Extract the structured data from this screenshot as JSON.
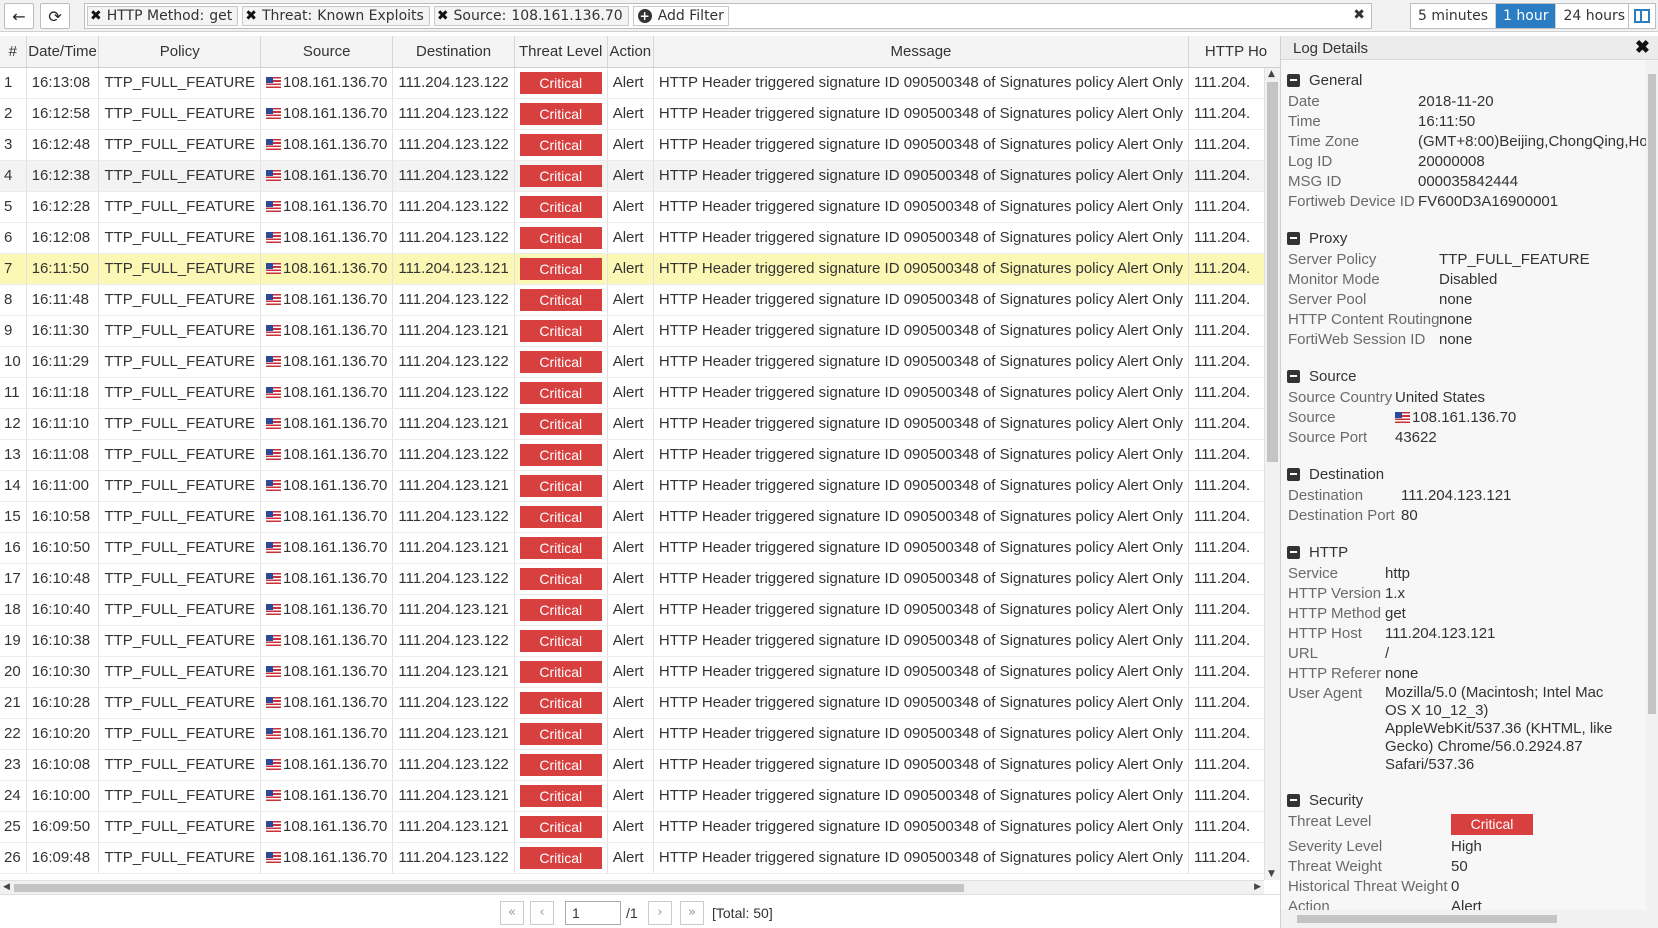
{
  "toolbar": {
    "filters": [
      {
        "key": "HTTP Method:",
        "value": "get"
      },
      {
        "key": "Threat:",
        "value": "Known Exploits"
      },
      {
        "key": "Source:",
        "value": "108.161.136.70"
      }
    ],
    "add_filter_label": "Add Filter",
    "time_ranges": [
      "5 minutes",
      "1 hour",
      "24 hours"
    ],
    "active_time_range": "1 hour"
  },
  "table": {
    "columns": [
      "#",
      "Date/Time",
      "Policy",
      "Source",
      "Destination",
      "Threat Level",
      "Action",
      "Message",
      "HTTP Ho"
    ],
    "rows": [
      {
        "n": "1",
        "time": "16:13:08",
        "policy": "TTP_FULL_FEATURE",
        "src": "108.161.136.70",
        "dst": "111.204.123.122",
        "level": "Critical",
        "action": "Alert",
        "msg": "HTTP Header triggered signature ID 090500348 of Signatures policy Alert Only",
        "host": "111.204."
      },
      {
        "n": "2",
        "time": "16:12:58",
        "policy": "TTP_FULL_FEATURE",
        "src": "108.161.136.70",
        "dst": "111.204.123.122",
        "level": "Critical",
        "action": "Alert",
        "msg": "HTTP Header triggered signature ID 090500348 of Signatures policy Alert Only",
        "host": "111.204."
      },
      {
        "n": "3",
        "time": "16:12:48",
        "policy": "TTP_FULL_FEATURE",
        "src": "108.161.136.70",
        "dst": "111.204.123.122",
        "level": "Critical",
        "action": "Alert",
        "msg": "HTTP Header triggered signature ID 090500348 of Signatures policy Alert Only",
        "host": "111.204."
      },
      {
        "n": "4",
        "time": "16:12:38",
        "policy": "TTP_FULL_FEATURE",
        "src": "108.161.136.70",
        "dst": "111.204.123.122",
        "level": "Critical",
        "action": "Alert",
        "msg": "HTTP Header triggered signature ID 090500348 of Signatures policy Alert Only",
        "host": "111.204."
      },
      {
        "n": "5",
        "time": "16:12:28",
        "policy": "TTP_FULL_FEATURE",
        "src": "108.161.136.70",
        "dst": "111.204.123.122",
        "level": "Critical",
        "action": "Alert",
        "msg": "HTTP Header triggered signature ID 090500348 of Signatures policy Alert Only",
        "host": "111.204."
      },
      {
        "n": "6",
        "time": "16:12:08",
        "policy": "TTP_FULL_FEATURE",
        "src": "108.161.136.70",
        "dst": "111.204.123.122",
        "level": "Critical",
        "action": "Alert",
        "msg": "HTTP Header triggered signature ID 090500348 of Signatures policy Alert Only",
        "host": "111.204."
      },
      {
        "n": "7",
        "time": "16:11:50",
        "policy": "TTP_FULL_FEATURE",
        "src": "108.161.136.70",
        "dst": "111.204.123.121",
        "level": "Critical",
        "action": "Alert",
        "msg": "HTTP Header triggered signature ID 090500348 of Signatures policy Alert Only",
        "host": "111.204."
      },
      {
        "n": "8",
        "time": "16:11:48",
        "policy": "TTP_FULL_FEATURE",
        "src": "108.161.136.70",
        "dst": "111.204.123.122",
        "level": "Critical",
        "action": "Alert",
        "msg": "HTTP Header triggered signature ID 090500348 of Signatures policy Alert Only",
        "host": "111.204."
      },
      {
        "n": "9",
        "time": "16:11:30",
        "policy": "TTP_FULL_FEATURE",
        "src": "108.161.136.70",
        "dst": "111.204.123.121",
        "level": "Critical",
        "action": "Alert",
        "msg": "HTTP Header triggered signature ID 090500348 of Signatures policy Alert Only",
        "host": "111.204."
      },
      {
        "n": "10",
        "time": "16:11:29",
        "policy": "TTP_FULL_FEATURE",
        "src": "108.161.136.70",
        "dst": "111.204.123.122",
        "level": "Critical",
        "action": "Alert",
        "msg": "HTTP Header triggered signature ID 090500348 of Signatures policy Alert Only",
        "host": "111.204."
      },
      {
        "n": "11",
        "time": "16:11:18",
        "policy": "TTP_FULL_FEATURE",
        "src": "108.161.136.70",
        "dst": "111.204.123.122",
        "level": "Critical",
        "action": "Alert",
        "msg": "HTTP Header triggered signature ID 090500348 of Signatures policy Alert Only",
        "host": "111.204."
      },
      {
        "n": "12",
        "time": "16:11:10",
        "policy": "TTP_FULL_FEATURE",
        "src": "108.161.136.70",
        "dst": "111.204.123.121",
        "level": "Critical",
        "action": "Alert",
        "msg": "HTTP Header triggered signature ID 090500348 of Signatures policy Alert Only",
        "host": "111.204."
      },
      {
        "n": "13",
        "time": "16:11:08",
        "policy": "TTP_FULL_FEATURE",
        "src": "108.161.136.70",
        "dst": "111.204.123.122",
        "level": "Critical",
        "action": "Alert",
        "msg": "HTTP Header triggered signature ID 090500348 of Signatures policy Alert Only",
        "host": "111.204."
      },
      {
        "n": "14",
        "time": "16:11:00",
        "policy": "TTP_FULL_FEATURE",
        "src": "108.161.136.70",
        "dst": "111.204.123.121",
        "level": "Critical",
        "action": "Alert",
        "msg": "HTTP Header triggered signature ID 090500348 of Signatures policy Alert Only",
        "host": "111.204."
      },
      {
        "n": "15",
        "time": "16:10:58",
        "policy": "TTP_FULL_FEATURE",
        "src": "108.161.136.70",
        "dst": "111.204.123.122",
        "level": "Critical",
        "action": "Alert",
        "msg": "HTTP Header triggered signature ID 090500348 of Signatures policy Alert Only",
        "host": "111.204."
      },
      {
        "n": "16",
        "time": "16:10:50",
        "policy": "TTP_FULL_FEATURE",
        "src": "108.161.136.70",
        "dst": "111.204.123.121",
        "level": "Critical",
        "action": "Alert",
        "msg": "HTTP Header triggered signature ID 090500348 of Signatures policy Alert Only",
        "host": "111.204."
      },
      {
        "n": "17",
        "time": "16:10:48",
        "policy": "TTP_FULL_FEATURE",
        "src": "108.161.136.70",
        "dst": "111.204.123.122",
        "level": "Critical",
        "action": "Alert",
        "msg": "HTTP Header triggered signature ID 090500348 of Signatures policy Alert Only",
        "host": "111.204."
      },
      {
        "n": "18",
        "time": "16:10:40",
        "policy": "TTP_FULL_FEATURE",
        "src": "108.161.136.70",
        "dst": "111.204.123.121",
        "level": "Critical",
        "action": "Alert",
        "msg": "HTTP Header triggered signature ID 090500348 of Signatures policy Alert Only",
        "host": "111.204."
      },
      {
        "n": "19",
        "time": "16:10:38",
        "policy": "TTP_FULL_FEATURE",
        "src": "108.161.136.70",
        "dst": "111.204.123.122",
        "level": "Critical",
        "action": "Alert",
        "msg": "HTTP Header triggered signature ID 090500348 of Signatures policy Alert Only",
        "host": "111.204."
      },
      {
        "n": "20",
        "time": "16:10:30",
        "policy": "TTP_FULL_FEATURE",
        "src": "108.161.136.70",
        "dst": "111.204.123.121",
        "level": "Critical",
        "action": "Alert",
        "msg": "HTTP Header triggered signature ID 090500348 of Signatures policy Alert Only",
        "host": "111.204."
      },
      {
        "n": "21",
        "time": "16:10:28",
        "policy": "TTP_FULL_FEATURE",
        "src": "108.161.136.70",
        "dst": "111.204.123.122",
        "level": "Critical",
        "action": "Alert",
        "msg": "HTTP Header triggered signature ID 090500348 of Signatures policy Alert Only",
        "host": "111.204."
      },
      {
        "n": "22",
        "time": "16:10:20",
        "policy": "TTP_FULL_FEATURE",
        "src": "108.161.136.70",
        "dst": "111.204.123.121",
        "level": "Critical",
        "action": "Alert",
        "msg": "HTTP Header triggered signature ID 090500348 of Signatures policy Alert Only",
        "host": "111.204."
      },
      {
        "n": "23",
        "time": "16:10:08",
        "policy": "TTP_FULL_FEATURE",
        "src": "108.161.136.70",
        "dst": "111.204.123.122",
        "level": "Critical",
        "action": "Alert",
        "msg": "HTTP Header triggered signature ID 090500348 of Signatures policy Alert Only",
        "host": "111.204."
      },
      {
        "n": "24",
        "time": "16:10:00",
        "policy": "TTP_FULL_FEATURE",
        "src": "108.161.136.70",
        "dst": "111.204.123.121",
        "level": "Critical",
        "action": "Alert",
        "msg": "HTTP Header triggered signature ID 090500348 of Signatures policy Alert Only",
        "host": "111.204."
      },
      {
        "n": "25",
        "time": "16:09:50",
        "policy": "TTP_FULL_FEATURE",
        "src": "108.161.136.70",
        "dst": "111.204.123.121",
        "level": "Critical",
        "action": "Alert",
        "msg": "HTTP Header triggered signature ID 090500348 of Signatures policy Alert Only",
        "host": "111.204."
      },
      {
        "n": "26",
        "time": "16:09:48",
        "policy": "TTP_FULL_FEATURE",
        "src": "108.161.136.70",
        "dst": "111.204.123.122",
        "level": "Critical",
        "action": "Alert",
        "msg": "HTTP Header triggered signature ID 090500348 of Signatures policy Alert Only",
        "host": "111.204."
      }
    ],
    "selected_row": "7",
    "alt_row": "4"
  },
  "pager": {
    "page": "1",
    "of": "/1",
    "total": "[Total: 50]"
  },
  "panel": {
    "title": "Log Details",
    "sections": [
      {
        "title": "General",
        "items": [
          {
            "k": "Date",
            "v": "2018-11-20"
          },
          {
            "k": "Time",
            "v": "16:11:50"
          },
          {
            "k": "Time Zone",
            "v": "(GMT+8:00)Beijing,ChongQing,Ho"
          },
          {
            "k": "Log ID",
            "v": "20000008"
          },
          {
            "k": "MSG ID",
            "v": "000035842444"
          },
          {
            "k": "Fortiweb Device ID",
            "v": "FV600D3A16900001"
          }
        ]
      },
      {
        "title": "Proxy",
        "items": [
          {
            "k": "Server Policy",
            "v": "TTP_FULL_FEATURE"
          },
          {
            "k": "Monitor Mode",
            "v": "Disabled"
          },
          {
            "k": "Server Pool",
            "v": "none"
          },
          {
            "k": "HTTP Content Routing",
            "v": "none"
          },
          {
            "k": "FortiWeb Session ID",
            "v": "none"
          }
        ]
      },
      {
        "title": "Source",
        "items": [
          {
            "k": "Source Country",
            "v": "United States"
          },
          {
            "k": "Source",
            "v": "108.161.136.70",
            "flag": true
          },
          {
            "k": "Source Port",
            "v": "43622"
          }
        ]
      },
      {
        "title": "Destination",
        "items": [
          {
            "k": "Destination",
            "v": "111.204.123.121"
          },
          {
            "k": "Destination Port",
            "v": "80"
          }
        ]
      },
      {
        "title": "HTTP",
        "items": [
          {
            "k": "Service",
            "v": "http"
          },
          {
            "k": "HTTP Version",
            "v": "1.x"
          },
          {
            "k": "HTTP Method",
            "v": "get"
          },
          {
            "k": "HTTP Host",
            "v": "111.204.123.121"
          },
          {
            "k": "URL",
            "v": "/"
          },
          {
            "k": "HTTP Referer",
            "v": "none"
          },
          {
            "k": "User Agent",
            "v": "Mozilla/5.0 (Macintosh; Intel Mac OS X 10_12_3) AppleWebKit/537.36 (KHTML, like Gecko) Chrome/56.0.2924.87 Safari/537.36",
            "wrap": true
          }
        ]
      },
      {
        "title": "Security",
        "items": [
          {
            "k": "Threat Level",
            "v": "Critical",
            "badge": true
          },
          {
            "k": "Severity Level",
            "v": "High"
          },
          {
            "k": "Threat Weight",
            "v": "50"
          },
          {
            "k": "Historical Threat Weight",
            "v": "0"
          },
          {
            "k": "Action",
            "v": "Alert"
          }
        ]
      }
    ]
  },
  "colors": {
    "accent": "#2a7dc2",
    "critical": "#d83f3f",
    "selected_row": "#fbf7b5"
  }
}
